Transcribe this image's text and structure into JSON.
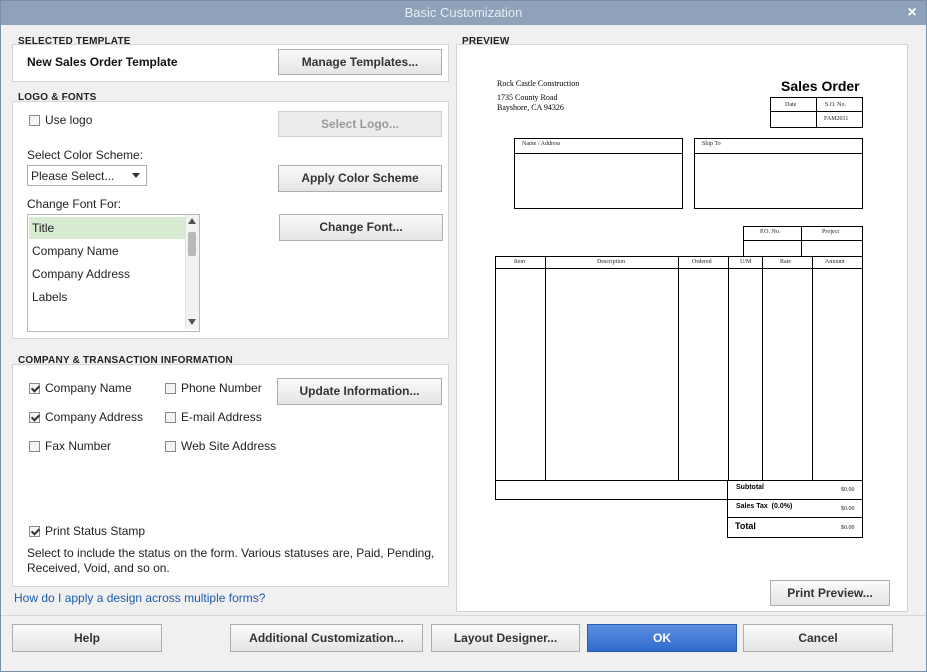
{
  "window": {
    "title": "Basic Customization"
  },
  "selected_template": {
    "section_label": "SELECTED TEMPLATE",
    "name": "New Sales Order Template",
    "manage_button": "Manage Templates..."
  },
  "logo_fonts": {
    "section_label": "LOGO & FONTS",
    "use_logo_label": "Use logo",
    "use_logo_checked": false,
    "select_logo_button": "Select Logo...",
    "color_scheme_label": "Select Color Scheme:",
    "color_scheme_value": "Please Select...",
    "apply_color_button": "Apply Color Scheme",
    "change_font_for_label": "Change Font For:",
    "font_items": [
      "Title",
      "Company Name",
      "Company Address",
      "Labels"
    ],
    "selected_font_item": "Title",
    "change_font_button": "Change Font..."
  },
  "company_info": {
    "section_label": "COMPANY & TRANSACTION INFORMATION",
    "company_name": {
      "label": "Company Name",
      "checked": true
    },
    "phone_number": {
      "label": "Phone Number",
      "checked": false
    },
    "company_address": {
      "label": "Company Address",
      "checked": true
    },
    "email_address": {
      "label": "E-mail Address",
      "checked": false
    },
    "fax_number": {
      "label": "Fax Number",
      "checked": false
    },
    "web_site_address": {
      "label": "Web Site Address",
      "checked": false
    },
    "update_button": "Update Information...",
    "print_status_stamp": {
      "label": "Print Status Stamp",
      "checked": true
    },
    "status_note": "Select to include the status on the form. Various statuses are, Paid, Pending, Received, Void, and so on."
  },
  "help_link": "How do I apply a design across multiple forms?",
  "preview": {
    "section_label": "PREVIEW",
    "company_name": "Rock Castle Construction",
    "address_line1": "1735 County Road",
    "address_line2": "Bayshore, CA 94326",
    "doc_title": "Sales Order",
    "date_header": "Date",
    "so_header": "S.O. No.",
    "so_value": "FAM2011",
    "name_address_label": "Name / Address",
    "ship_to_label": "Ship To",
    "po_header": "P.O. No.",
    "project_header": "Project",
    "columns": [
      "Item",
      "Description",
      "Ordered",
      "U/M",
      "Rate",
      "Amount"
    ],
    "subtotal_label": "Subtotal",
    "subtotal_value": "$0.00",
    "sales_tax_label": "Sales Tax  (0.0%)",
    "sales_tax_value": "$0.00",
    "total_label": "Total",
    "total_value": "$0.00",
    "print_preview_button": "Print Preview..."
  },
  "footer": {
    "help_button": "Help",
    "additional_button": "Additional Customization...",
    "layout_button": "Layout Designer...",
    "ok_button": "OK",
    "cancel_button": "Cancel"
  }
}
